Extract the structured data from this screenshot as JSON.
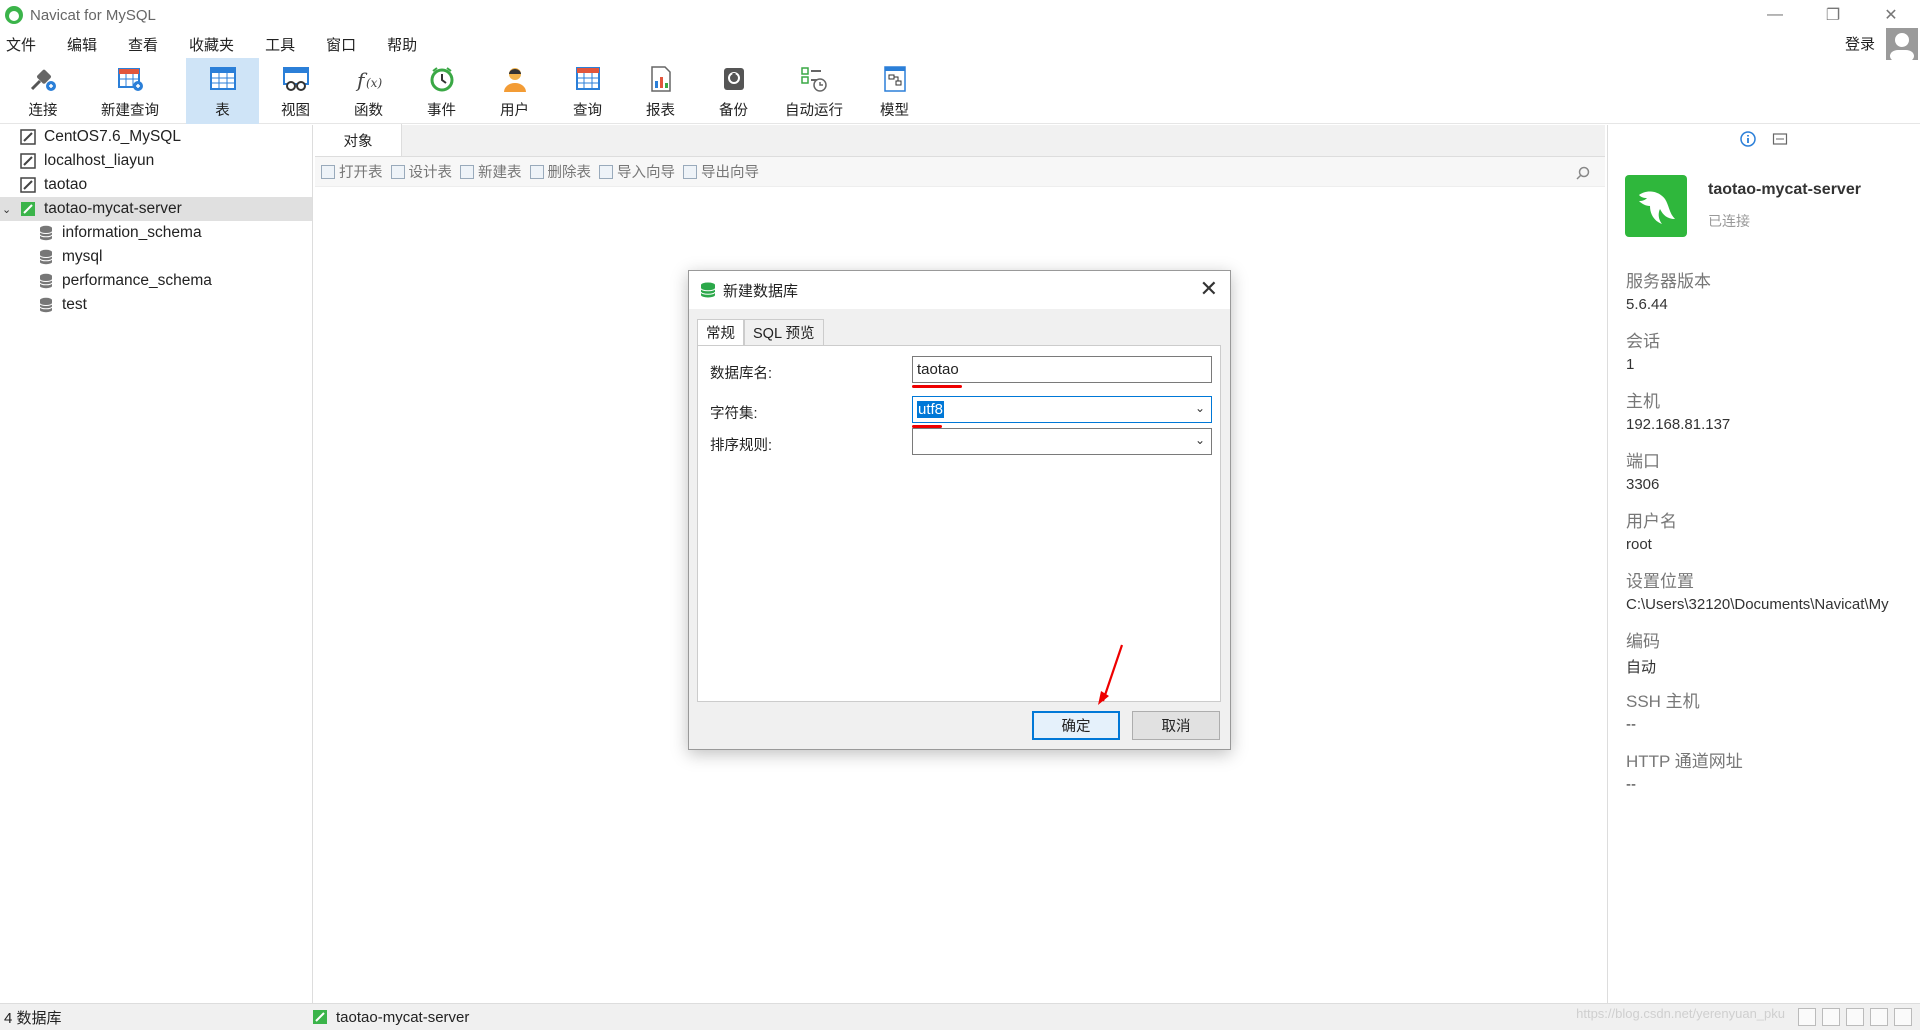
{
  "window": {
    "title": "Navicat for MySQL"
  },
  "menu": [
    "文件",
    "编辑",
    "查看",
    "收藏夹",
    "工具",
    "窗口",
    "帮助"
  ],
  "login": "登录",
  "toolbar": {
    "connect": "连接",
    "new_query": "新建查询",
    "items": [
      "表",
      "视图",
      "函数",
      "事件",
      "用户",
      "查询",
      "报表",
      "备份",
      "自动运行",
      "模型"
    ]
  },
  "tree": {
    "connections": [
      "CentOS7.6_MySQL",
      "localhost_liayun",
      "taotao",
      "taotao-mycat-server"
    ],
    "databases": [
      "information_schema",
      "mysql",
      "performance_schema",
      "test"
    ]
  },
  "center": {
    "tab": "对象",
    "actions": [
      "打开表",
      "设计表",
      "新建表",
      "删除表",
      "导入向导",
      "导出向导"
    ]
  },
  "dialog": {
    "title": "新建数据库",
    "tabs": [
      "常规",
      "SQL 预览"
    ],
    "db_name_label": "数据库名:",
    "db_name_value": "taotao",
    "charset_label": "字符集:",
    "charset_value": "utf8",
    "collation_label": "排序规则:",
    "collation_value": "",
    "ok": "确定",
    "cancel": "取消"
  },
  "info": {
    "name": "taotao-mycat-server",
    "status": "已连接",
    "props": [
      {
        "label": "服务器版本",
        "value": "5.6.44"
      },
      {
        "label": "会话",
        "value": "1"
      },
      {
        "label": "主机",
        "value": "192.168.81.137"
      },
      {
        "label": "端口",
        "value": "3306"
      },
      {
        "label": "用户名",
        "value": "root"
      },
      {
        "label": "设置位置",
        "value": "C:\\Users\\32120\\Documents\\Navicat\\My"
      },
      {
        "label": "编码",
        "value": "自动"
      },
      {
        "label": "SSH 主机",
        "value": "--"
      },
      {
        "label": "HTTP 通道网址",
        "value": "--"
      }
    ]
  },
  "status": {
    "left": "4 数据库",
    "connection": "taotao-mycat-server",
    "watermark": "https://blog.csdn.net/yerenyuan_pku"
  },
  "colors": {
    "accent": "#0078d7",
    "navicat_green": "#2fb73c",
    "active_tab": "#cfe4f7"
  }
}
